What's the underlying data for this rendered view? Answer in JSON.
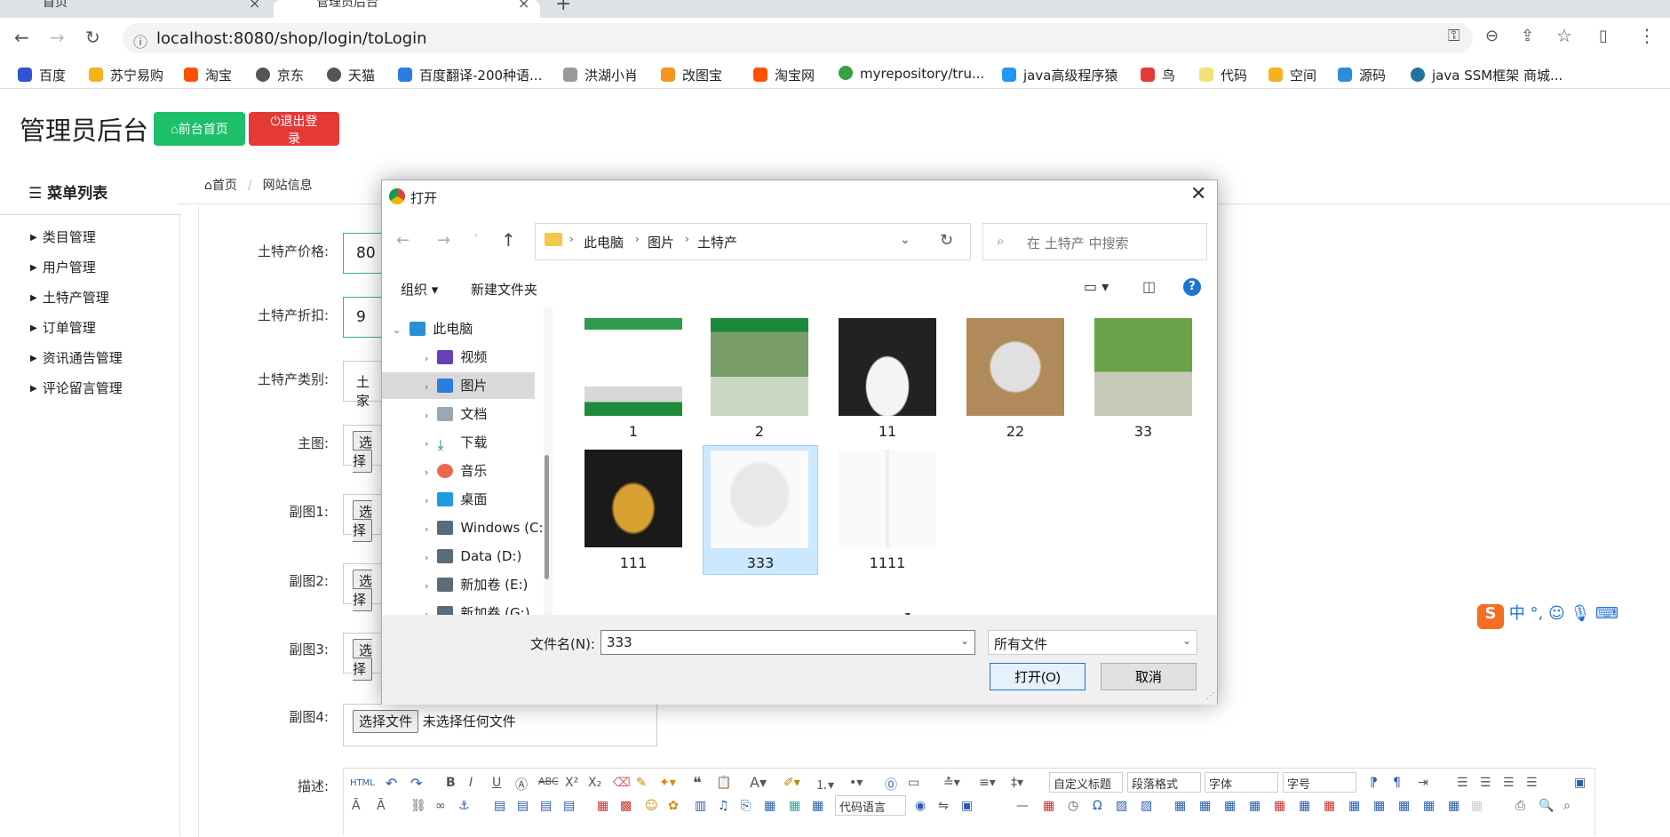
{
  "browser": {
    "tabs": [
      "首页",
      "管理员后台"
    ],
    "url": "localhost:8080/shop/login/toLogin",
    "bookmarks": [
      "百度",
      "苏宁易购",
      "淘宝",
      "京东",
      "天猫",
      "百度翻译-200种语...",
      "洪湖小肖",
      "改图宝",
      "淘宝网",
      "myrepository/tru...",
      "java高级程序猿",
      "鸟",
      "代码",
      "空间",
      "源码",
      "java SSM框架 商城..."
    ]
  },
  "admin": {
    "title": "管理员后台",
    "front_button": "前台首页",
    "logout_button": "退出登录",
    "menu_header": "菜单列表",
    "menu": [
      "类目管理",
      "用户管理",
      "土特产管理",
      "订单管理",
      "资讯通告管理",
      "评论留言管理"
    ],
    "breadcrumb": [
      "首页",
      "网站信息"
    ],
    "form": {
      "price_label": "土特产价格:",
      "price_value": "80",
      "discount_label": "土特产折扣:",
      "discount_value": "9",
      "category_label": "土特产类别:",
      "category_value": "土家",
      "main_image_label": "主图:",
      "sub1_label": "副图1:",
      "sub2_label": "副图2:",
      "sub3_label": "副图3:",
      "sub4_label": "副图4:",
      "choose_file": "选择文件",
      "choose_file_cut": "选择",
      "no_file": "未选择任何文件",
      "desc_label": "描述:"
    },
    "editor": {
      "custom_title": "自定义标题",
      "paragraph": "段落格式",
      "font": "字体",
      "font_size": "字号",
      "code_lang": "代码语言"
    }
  },
  "dialog": {
    "title": "打开",
    "path": [
      "此电脑",
      "图片",
      "土特产"
    ],
    "search_placeholder": "在 土特产 中搜索",
    "organize": "组织",
    "new_folder": "新建文件夹",
    "nav": [
      "此电脑",
      "视频",
      "图片",
      "文档",
      "下载",
      "音乐",
      "桌面",
      "Windows (C:)",
      "Data (D:)",
      "新加卷 (E:)",
      "新加卷 (G:)"
    ],
    "files": [
      "1",
      "2",
      "11",
      "22",
      "33",
      "111",
      "333",
      "1111"
    ],
    "selected": "333",
    "filename_label": "文件名(N):",
    "filename_value": "333",
    "filetype": "所有文件",
    "open_button": "打开(O)",
    "cancel_button": "取消"
  },
  "ime": {
    "label": "中"
  },
  "colors": {
    "green": "#1dbf6a",
    "red": "#e53935",
    "selection": "#cce8ff"
  }
}
